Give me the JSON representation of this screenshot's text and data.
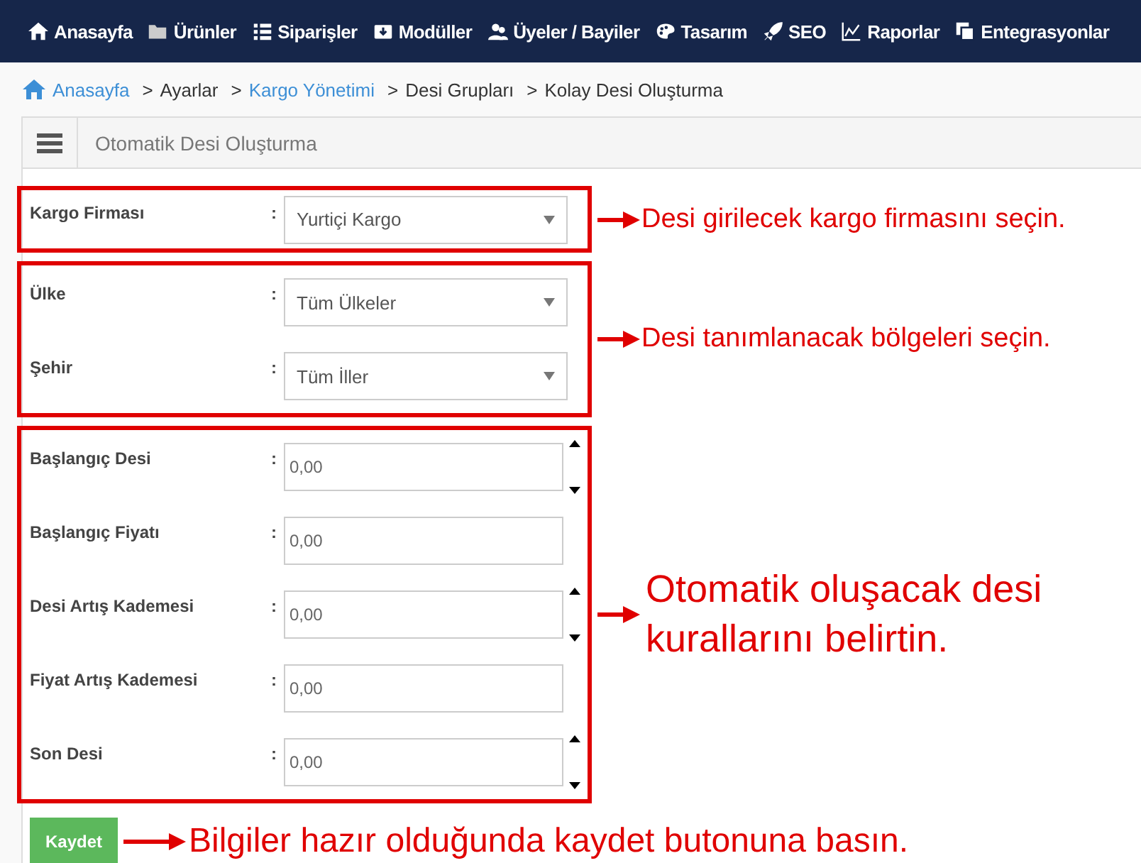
{
  "nav": [
    {
      "label": "Anasayfa"
    },
    {
      "label": "Ürünler"
    },
    {
      "label": "Siparişler"
    },
    {
      "label": "Modüller"
    },
    {
      "label": "Üyeler / Bayiler"
    },
    {
      "label": "Tasarım"
    },
    {
      "label": "SEO"
    },
    {
      "label": "Raporlar"
    },
    {
      "label": "Entegrasyonlar"
    }
  ],
  "breadcrumb": [
    {
      "label": "Anasayfa",
      "link": true
    },
    {
      "label": "Ayarlar",
      "link": false
    },
    {
      "label": "Kargo Yönetimi",
      "link": true
    },
    {
      "label": "Desi Grupları",
      "link": false
    },
    {
      "label": "Kolay Desi Oluşturma",
      "link": false
    }
  ],
  "breadcrumb_separator": ">",
  "panel": {
    "title": "Otomatik Desi Oluşturma"
  },
  "groups": [
    {
      "annotation": "Desi girilecek kargo firmasını seçin.",
      "fields": [
        {
          "label": "Kargo Firması",
          "kind": "select",
          "value": "Yurtiçi Kargo"
        }
      ]
    },
    {
      "annotation": "Desi tanımlanacak bölgeleri seçin.",
      "fields": [
        {
          "label": "Ülke",
          "kind": "select",
          "value": "Tüm Ülkeler"
        },
        {
          "label": "Şehir",
          "kind": "select",
          "value": "Tüm İller"
        }
      ]
    },
    {
      "annotation": "Otomatik oluşacak desi kurallarını belirtin.",
      "fields": [
        {
          "label": "Başlangıç Desi",
          "kind": "spinner",
          "value": "0,00"
        },
        {
          "label": "Başlangıç Fiyatı",
          "kind": "text",
          "value": "0,00"
        },
        {
          "label": "Desi Artış Kademesi",
          "kind": "spinner",
          "value": "0,00"
        },
        {
          "label": "Fiyat Artış Kademesi",
          "kind": "text",
          "value": "0,00"
        },
        {
          "label": "Son Desi",
          "kind": "spinner",
          "value": "0,00"
        }
      ]
    }
  ],
  "colon": ":",
  "save": {
    "label": "Kaydet",
    "annotation": "Bilgiler hazır olduğunda kaydet butonuna basın."
  }
}
